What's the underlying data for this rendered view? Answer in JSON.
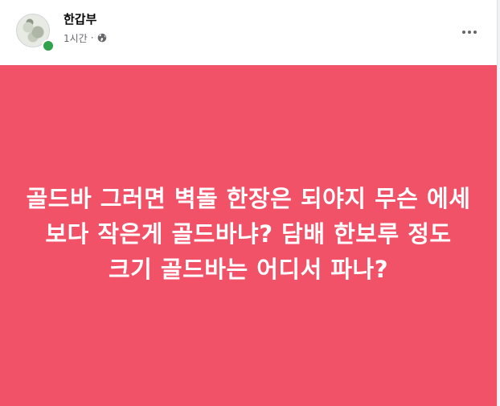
{
  "post": {
    "author": "한갑부",
    "time": "1시간",
    "separator": "·",
    "privacy_icon": "globe-icon",
    "more_icon": "more-options-icon",
    "body_text": "골드바 그러면 벽돌 한장은 되야지 무슨 에세 보다 작은게 골드바냐? 담배 한보루 정도 크기 골드바는 어디서 파나?",
    "background_color": "#f25268",
    "text_color": "#ffffff",
    "online_status_color": "#31a24c"
  }
}
